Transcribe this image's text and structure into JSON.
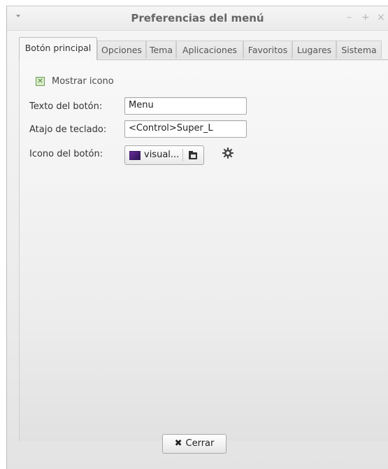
{
  "window": {
    "title": "Preferencias del menú",
    "controls": {
      "minimize": "–",
      "maximize": "+",
      "close": "×"
    }
  },
  "tabs": [
    {
      "label": "Botón principal",
      "active": true
    },
    {
      "label": "Opciones",
      "active": false
    },
    {
      "label": "Tema",
      "active": false
    },
    {
      "label": "Aplicaciones",
      "active": false
    },
    {
      "label": "Favoritos",
      "active": false
    },
    {
      "label": "Lugares",
      "active": false
    },
    {
      "label": "Sistema",
      "active": false
    }
  ],
  "main_button": {
    "show_icon": {
      "label": "Mostrar icono",
      "checked": true
    },
    "button_text": {
      "label": "Texto del botón:",
      "value": "Menu"
    },
    "shortcut": {
      "label": "Atajo de teclado:",
      "value": "<Control>Super_L"
    },
    "button_icon": {
      "label": "Icono del botón:",
      "value": "visual...",
      "icon": "image-icon",
      "browse_icon": "folder-icon"
    },
    "settings_icon": "gear-icon"
  },
  "footer": {
    "close": {
      "label": "Cerrar",
      "icon": "close-icon"
    }
  }
}
